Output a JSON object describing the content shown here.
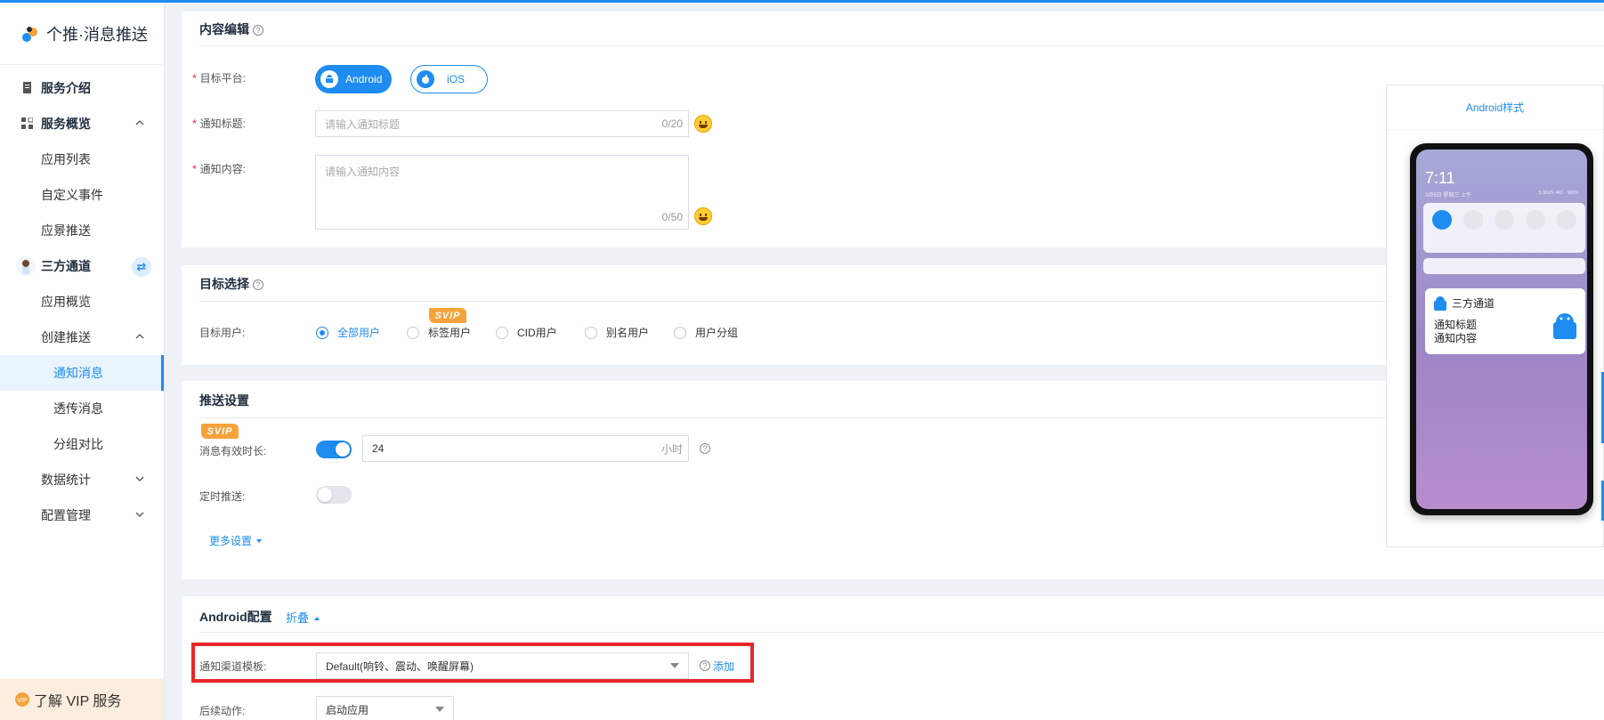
{
  "app": {
    "brand": "个推·消息推送",
    "vip_service": "了解 VIP 服务"
  },
  "sidebar": {
    "items": [
      {
        "label": "服务介绍"
      },
      {
        "label": "服务概览"
      },
      {
        "label": "应用列表"
      },
      {
        "label": "自定义事件"
      },
      {
        "label": "应景推送"
      },
      {
        "label": "三方通道"
      },
      {
        "label": "应用概览"
      },
      {
        "label": "创建推送"
      },
      {
        "label": "通知消息"
      },
      {
        "label": "透传消息"
      },
      {
        "label": "分组对比"
      },
      {
        "label": "数据统计"
      },
      {
        "label": "配置管理"
      }
    ]
  },
  "content_edit": {
    "title": "内容编辑",
    "platform_label": "目标平台:",
    "platform_android": "Android",
    "platform_ios": "iOS",
    "title_label": "通知标题:",
    "title_placeholder": "请输入通知标题",
    "title_counter": "0/20",
    "content_label": "通知内容:",
    "content_placeholder": "请输入通知内容",
    "content_counter": "0/50"
  },
  "target": {
    "title": "目标选择",
    "users_label": "目标用户:",
    "badge": "SVIP",
    "options": [
      "全部用户",
      "标签用户",
      "CID用户",
      "别名用户",
      "用户分组"
    ]
  },
  "push_settings": {
    "title": "推送设置",
    "badge": "SVIP",
    "validity_label": "消息有效时长:",
    "validity_value": "24",
    "validity_unit": "小时",
    "scheduled_label": "定时推送:",
    "more_settings": "更多设置"
  },
  "android_config": {
    "title": "Android配置",
    "collapse": "折叠",
    "channel_label": "通知渠道模板:",
    "channel_value": "Default(响铃、震动、唤醒屏幕)",
    "add": "添加",
    "follow_label": "后续动作:",
    "follow_value": "启动应用"
  },
  "preview": {
    "title": "Android样式",
    "time": "7:11",
    "date": "3月5日 星期三 上午",
    "status": "5.9G/s 4G · 98%",
    "app_name": "三方通道",
    "notif_title": "通知标题",
    "notif_body": "通知内容"
  },
  "colors": {
    "accent": "#1e8cf0",
    "highlight": "#e8262b",
    "svip": "#f5a33a"
  }
}
